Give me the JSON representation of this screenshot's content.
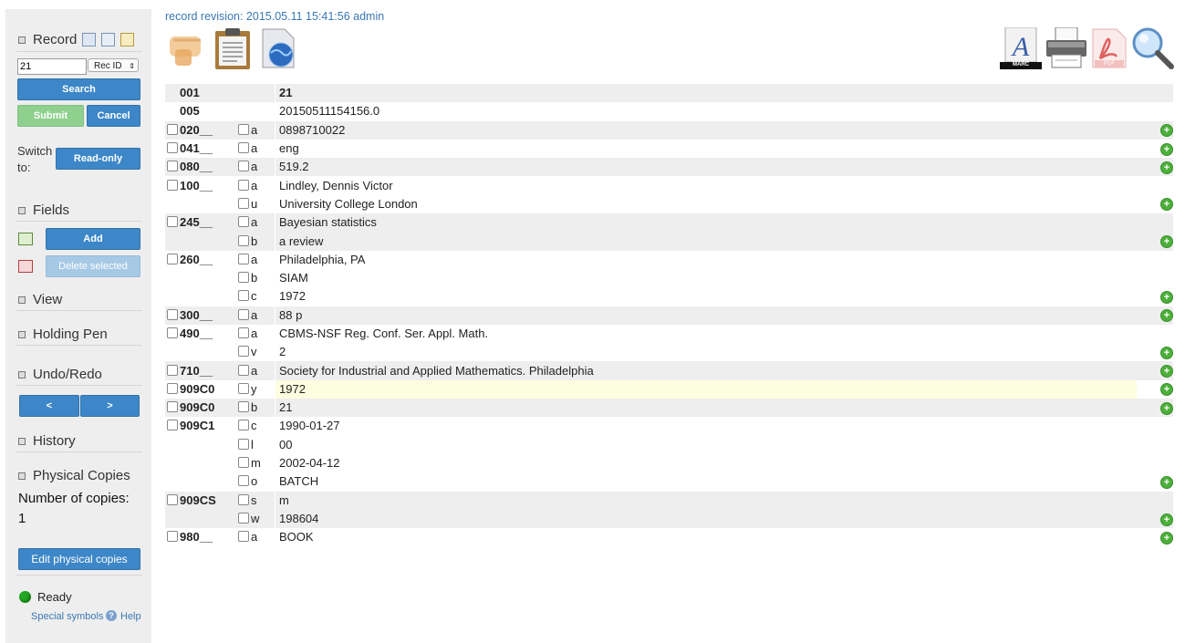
{
  "sidebar": {
    "record": {
      "title": "Record",
      "rec_value": "21",
      "rec_type": "Rec ID",
      "search_label": "Search",
      "submit_label": "Submit",
      "cancel_label": "Cancel"
    },
    "switch": {
      "label": "Switch to:",
      "readonly_label": "Read-only"
    },
    "fields": {
      "title": "Fields",
      "add_label": "Add",
      "delete_label": "Delete selected"
    },
    "view": {
      "title": "View"
    },
    "holding_pen": {
      "title": "Holding Pen"
    },
    "undo_redo": {
      "title": "Undo/Redo",
      "undo_label": "<",
      "redo_label": ">"
    },
    "history": {
      "title": "History"
    },
    "physical": {
      "title": "Physical Copies",
      "count_label": "Number of copies:",
      "count": "1",
      "edit_label": "Edit physical copies"
    },
    "status": {
      "text": "Ready",
      "color": "#22aa22"
    },
    "links": {
      "special": "Special symbols",
      "help": "Help"
    }
  },
  "header": {
    "revision": "record revision: 2015.05.11 15:41:56 admin"
  },
  "toolbar_left": [
    "hand-icon",
    "clipboard-icon",
    "globe-document-icon"
  ],
  "toolbar_right": [
    {
      "icon": "marc-icon",
      "label": "MARC"
    },
    {
      "icon": "printer-icon"
    },
    {
      "icon": "pdf-icon",
      "label": "PDF"
    },
    {
      "icon": "magnifier-icon"
    }
  ],
  "record": [
    {
      "tag": "001",
      "code": "",
      "value": "21",
      "checkbox": false,
      "shaded": true,
      "add": false
    },
    {
      "tag": "005",
      "code": "",
      "value": "20150511154156.0",
      "checkbox": false,
      "shaded": false,
      "add": false
    },
    {
      "tag": "020__",
      "code": "a",
      "value": "0898710022",
      "checkbox": true,
      "shaded": true,
      "add": true
    },
    {
      "tag": "041__",
      "code": "a",
      "value": "eng",
      "checkbox": true,
      "shaded": false,
      "add": true
    },
    {
      "tag": "080__",
      "code": "a",
      "value": "519.2",
      "checkbox": true,
      "shaded": true,
      "add": true
    },
    {
      "tag": "100__",
      "code": "a",
      "value": "Lindley, Dennis Victor",
      "checkbox": true,
      "shaded": false,
      "add": false
    },
    {
      "tag": "",
      "code": "u",
      "value": "University College London",
      "checkbox": false,
      "shaded": false,
      "add": true
    },
    {
      "tag": "245__",
      "code": "a",
      "value": "Bayesian statistics",
      "checkbox": true,
      "shaded": true,
      "add": false
    },
    {
      "tag": "",
      "code": "b",
      "value": "a review",
      "checkbox": false,
      "shaded": true,
      "add": true
    },
    {
      "tag": "260__",
      "code": "a",
      "value": "Philadelphia, PA",
      "checkbox": true,
      "shaded": false,
      "add": false
    },
    {
      "tag": "",
      "code": "b",
      "value": "SIAM",
      "checkbox": false,
      "shaded": false,
      "add": false
    },
    {
      "tag": "",
      "code": "c",
      "value": "1972",
      "checkbox": false,
      "shaded": false,
      "add": true
    },
    {
      "tag": "300__",
      "code": "a",
      "value": "88 p",
      "checkbox": true,
      "shaded": true,
      "add": true
    },
    {
      "tag": "490__",
      "code": "a",
      "value": "CBMS-NSF Reg. Conf. Ser. Appl. Math.",
      "checkbox": true,
      "shaded": false,
      "add": false
    },
    {
      "tag": "",
      "code": "v",
      "value": "2",
      "checkbox": false,
      "shaded": false,
      "add": true
    },
    {
      "tag": "710__",
      "code": "a",
      "value": "Society for Industrial and Applied Mathematics. Philadelphia",
      "checkbox": true,
      "shaded": true,
      "add": true
    },
    {
      "tag": "909C0",
      "code": "y",
      "value": "1972",
      "checkbox": true,
      "shaded": false,
      "add": true,
      "highlight": true
    },
    {
      "tag": "909C0",
      "code": "b",
      "value": "21",
      "checkbox": true,
      "shaded": true,
      "add": true
    },
    {
      "tag": "909C1",
      "code": "c",
      "value": "1990-01-27",
      "checkbox": true,
      "shaded": false,
      "add": false
    },
    {
      "tag": "",
      "code": "l",
      "value": "00",
      "checkbox": false,
      "shaded": false,
      "add": false
    },
    {
      "tag": "",
      "code": "m",
      "value": "2002-04-12",
      "checkbox": false,
      "shaded": false,
      "add": false
    },
    {
      "tag": "",
      "code": "o",
      "value": "BATCH",
      "checkbox": false,
      "shaded": false,
      "add": true
    },
    {
      "tag": "909CS",
      "code": "s",
      "value": "m",
      "checkbox": true,
      "shaded": true,
      "add": false
    },
    {
      "tag": "",
      "code": "w",
      "value": "198604",
      "checkbox": false,
      "shaded": true,
      "add": true
    },
    {
      "tag": "980__",
      "code": "a",
      "value": "BOOK",
      "checkbox": true,
      "shaded": false,
      "add": true
    }
  ]
}
